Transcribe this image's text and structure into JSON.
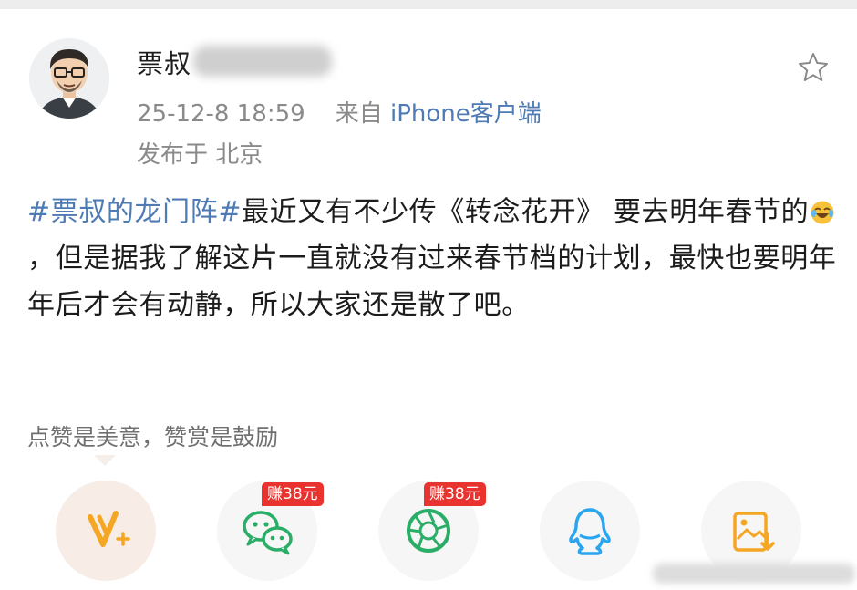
{
  "user": {
    "name": "票叔",
    "avatar_icon": "avatar-icon"
  },
  "post_meta": {
    "time": "25-12-8 18:59",
    "from_prefix": "来自",
    "source": "iPhone客户端",
    "location": "发布于 北京"
  },
  "post": {
    "hashtag": "#票叔的龙门阵#",
    "text_1": "最近又有不少传《转念花开》 要去明年春节的",
    "emoji": "laugh-cry-emoji",
    "text_2": "，但是据我了解这片一直就没有过来春节档的计划，最快也要明年年后才会有动静，所以大家还是散了吧。"
  },
  "reward": {
    "text": "点赞是美意，赞赏是鼓励"
  },
  "share": [
    {
      "name": "v-plus",
      "icon": "v-plus-icon",
      "badge": ""
    },
    {
      "name": "wechat",
      "icon": "wechat-icon",
      "badge": "赚38元"
    },
    {
      "name": "moments",
      "icon": "moments-icon",
      "badge": "赚38元"
    },
    {
      "name": "qq",
      "icon": "qq-icon",
      "badge": ""
    },
    {
      "name": "save-image",
      "icon": "save-image-icon",
      "badge": ""
    }
  ],
  "colors": {
    "link": "#4e7bb3",
    "meta": "#8a8a8a",
    "badge": "#e8332f",
    "wechat": "#2aae67",
    "qq": "#2aa6f0",
    "accent_orange": "#f5a623"
  }
}
